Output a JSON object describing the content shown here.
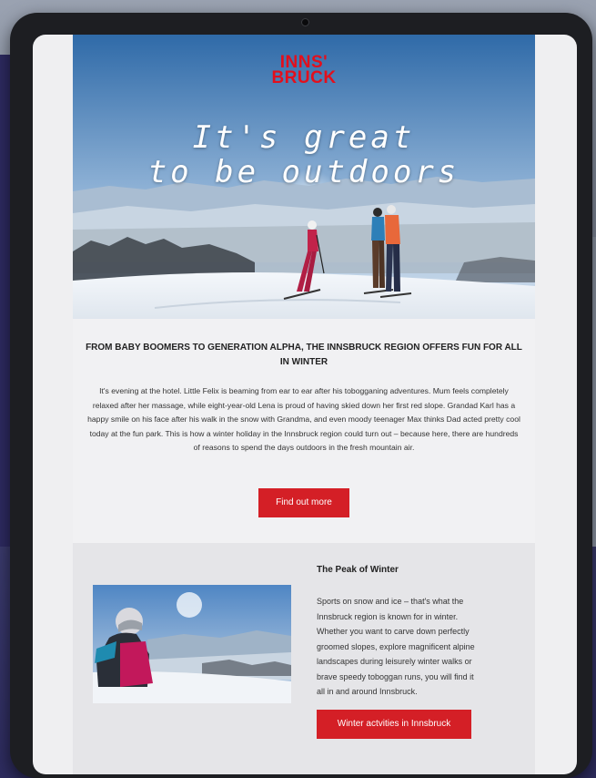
{
  "brand": {
    "logo_line1": "INNS'",
    "logo_line2": "BRUCK"
  },
  "hero": {
    "headline_line1": "It's great",
    "headline_line2": "to be outdoors"
  },
  "intro": {
    "title": "FROM BABY BOOMERS TO GENERATION ALPHA, THE INNSBRUCK REGION OFFERS FUN FOR ALL IN WINTER",
    "body": "It's evening at the hotel. Little Felix is beaming from ear to ear after his tobogganing adventures. Mum feels completely relaxed after her massage, while eight-year-old Lena is proud of having skied down her first red slope. Grandad Karl has a happy smile on his face after his walk in the snow with Grandma, and even moody teenager Max thinks Dad acted pretty cool today at the fun park. This is how a winter holiday in the Innsbruck region could turn out – because here, there are hundreds of reasons to spend the days outdoors in the fresh mountain air.",
    "button_label": "Find out more"
  },
  "feature": {
    "title": "The Peak of Winter",
    "body": "Sports on snow and ice – that's what the Innsbruck region is known for in winter. Whether you want to carve down perfectly groomed slopes, explore magnificent alpine landscapes during leisurely winter walks or brave speedy toboggan runs, you will find it all in and around Innsbruck.",
    "button_label": "Winter actvities in Innsbruck"
  },
  "colors": {
    "brand_red": "#e30f1c",
    "button_red": "#d41f26",
    "backdrop_purple": "#2d2a60"
  }
}
